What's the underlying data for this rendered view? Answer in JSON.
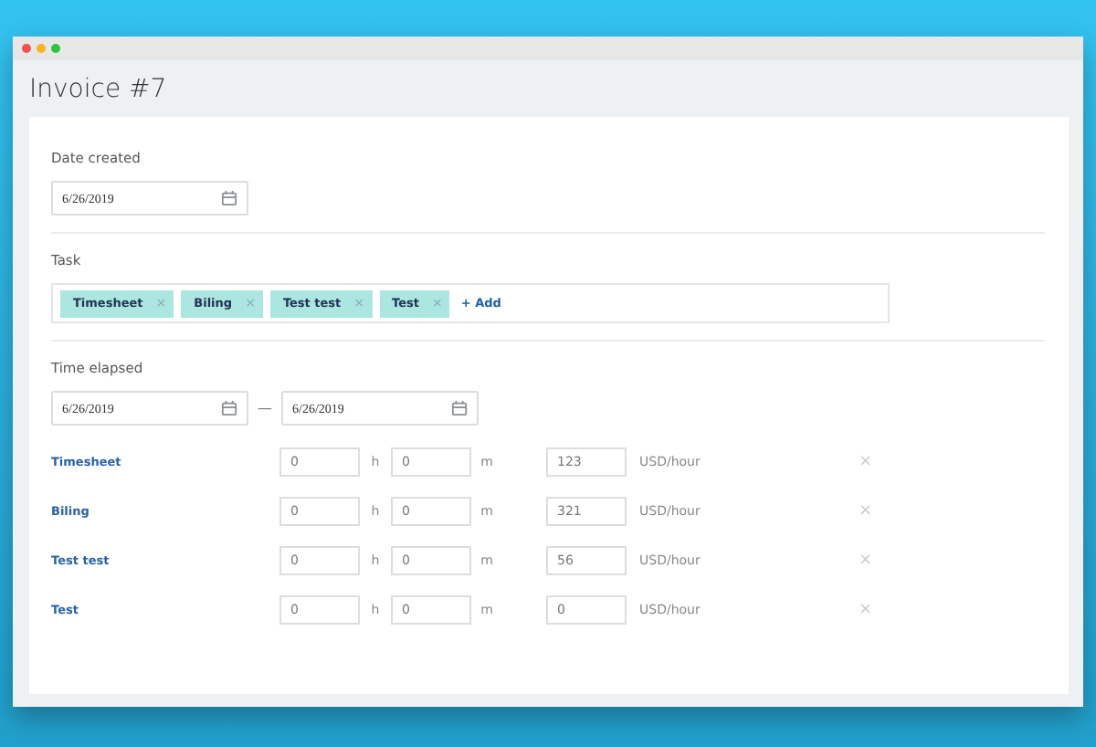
{
  "window": {
    "title": "Invoice #7"
  },
  "date_created": {
    "label": "Date created",
    "value": "6/26/2019"
  },
  "task": {
    "label": "Task",
    "tags": [
      {
        "label": "Timesheet",
        "remove": "×"
      },
      {
        "label": "Biling",
        "remove": "×"
      },
      {
        "label": "Test test",
        "remove": "×"
      },
      {
        "label": "Test",
        "remove": "×"
      }
    ],
    "add": "+ Add"
  },
  "time_elapsed": {
    "label": "Time elapsed",
    "from": "6/26/2019",
    "separator": "—",
    "to": "6/26/2019"
  },
  "rows": [
    {
      "task": "Timesheet",
      "hours": "0",
      "hours_unit": "h",
      "minutes": "0",
      "minutes_unit": "m",
      "rate": "123",
      "rate_unit": "USD/hour",
      "remove": "×"
    },
    {
      "task": "Biling",
      "hours": "0",
      "hours_unit": "h",
      "minutes": "0",
      "minutes_unit": "m",
      "rate": "321",
      "rate_unit": "USD/hour",
      "remove": "×"
    },
    {
      "task": "Test test",
      "hours": "0",
      "hours_unit": "h",
      "minutes": "0",
      "minutes_unit": "m",
      "rate": "56",
      "rate_unit": "USD/hour",
      "remove": "×"
    },
    {
      "task": "Test",
      "hours": "0",
      "hours_unit": "h",
      "minutes": "0",
      "minutes_unit": "m",
      "rate": "0",
      "rate_unit": "USD/hour",
      "remove": "×"
    }
  ]
}
